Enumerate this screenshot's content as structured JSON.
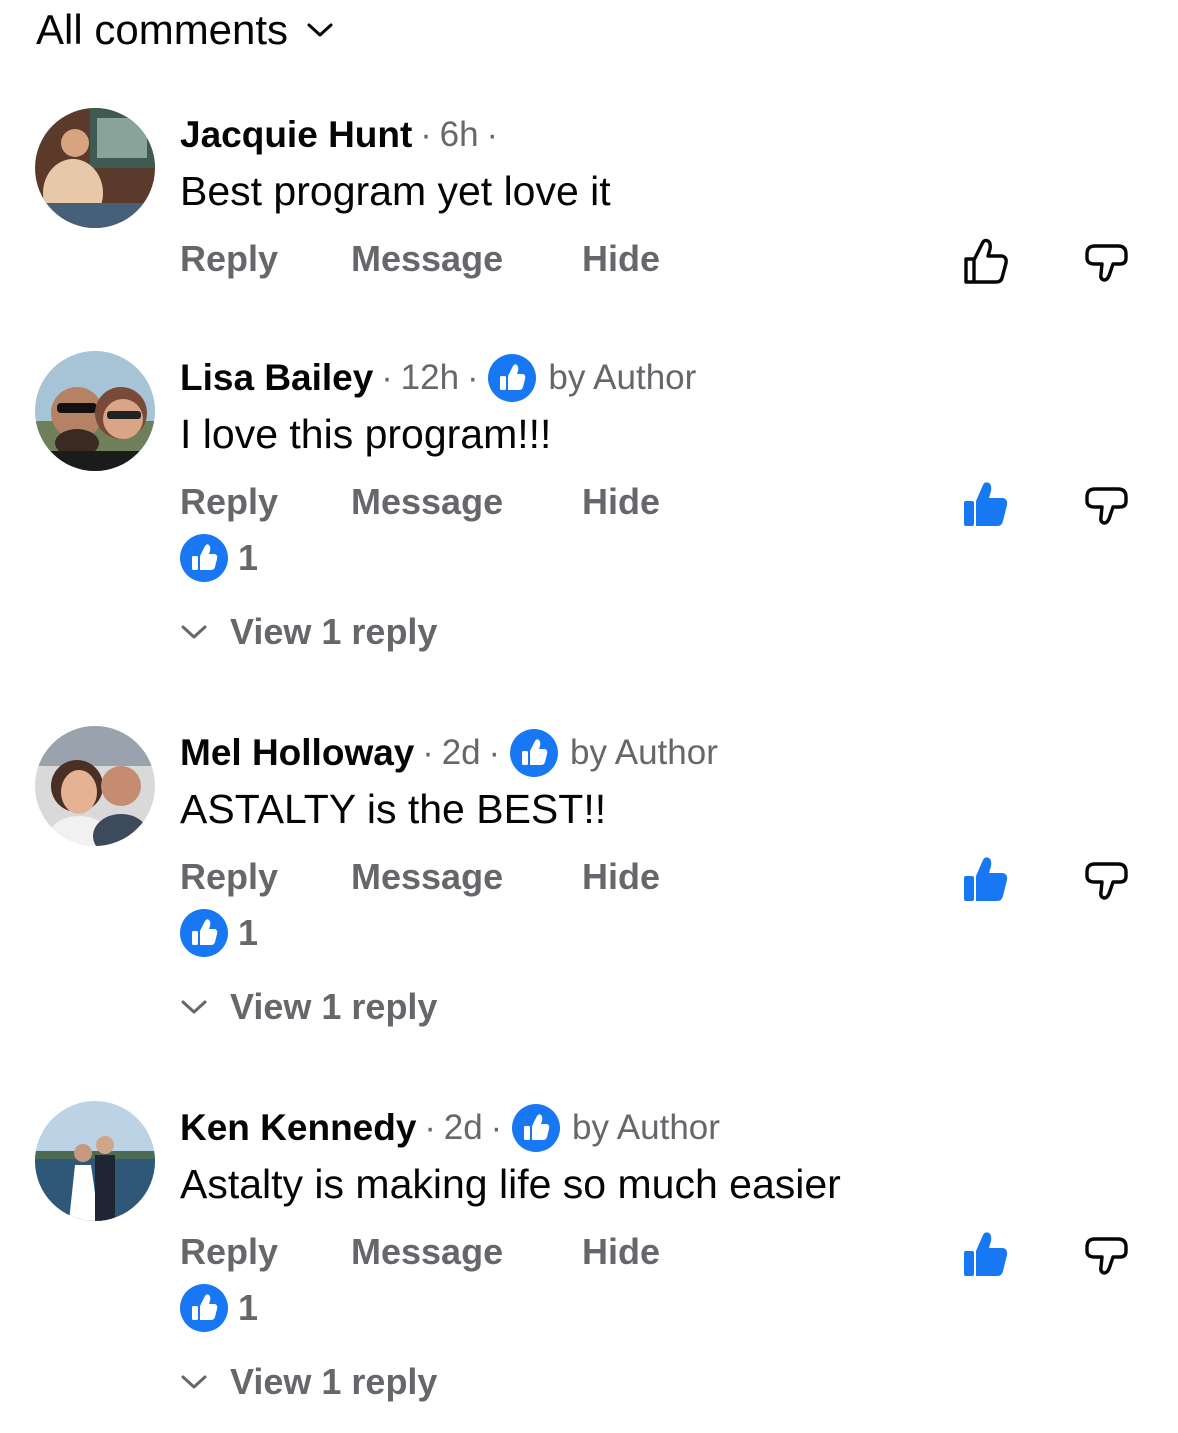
{
  "filter": {
    "label": "All comments",
    "icon": "chevron-down-icon"
  },
  "colors": {
    "accent": "#1877f2",
    "secondary_text": "#65676b",
    "primary_text": "#050505"
  },
  "actions": {
    "reply": "Reply",
    "message": "Message",
    "hide": "Hide"
  },
  "comments": [
    {
      "name": "Jacquie Hunt",
      "time": "6h",
      "trailing_sep": "·",
      "liked_by_author": false,
      "text": "Best program yet love it",
      "upvoted": false,
      "reactions": null,
      "view_replies": null
    },
    {
      "name": "Lisa Bailey",
      "time": "12h",
      "liked_by_author": true,
      "by_author": "by Author",
      "text": "I love this program!!!",
      "upvoted": true,
      "reactions": "1",
      "view_replies": "View 1 reply"
    },
    {
      "name": "Mel Holloway",
      "time": "2d",
      "liked_by_author": true,
      "by_author": "by Author",
      "text": "ASTALTY is the BEST!!",
      "upvoted": true,
      "reactions": "1",
      "view_replies": "View 1 reply"
    },
    {
      "name": "Ken Kennedy",
      "time": "2d",
      "liked_by_author": true,
      "by_author": "by Author",
      "text": "Astalty is making life so much easier",
      "upvoted": true,
      "reactions": "1",
      "view_replies": "View 1 reply"
    }
  ]
}
